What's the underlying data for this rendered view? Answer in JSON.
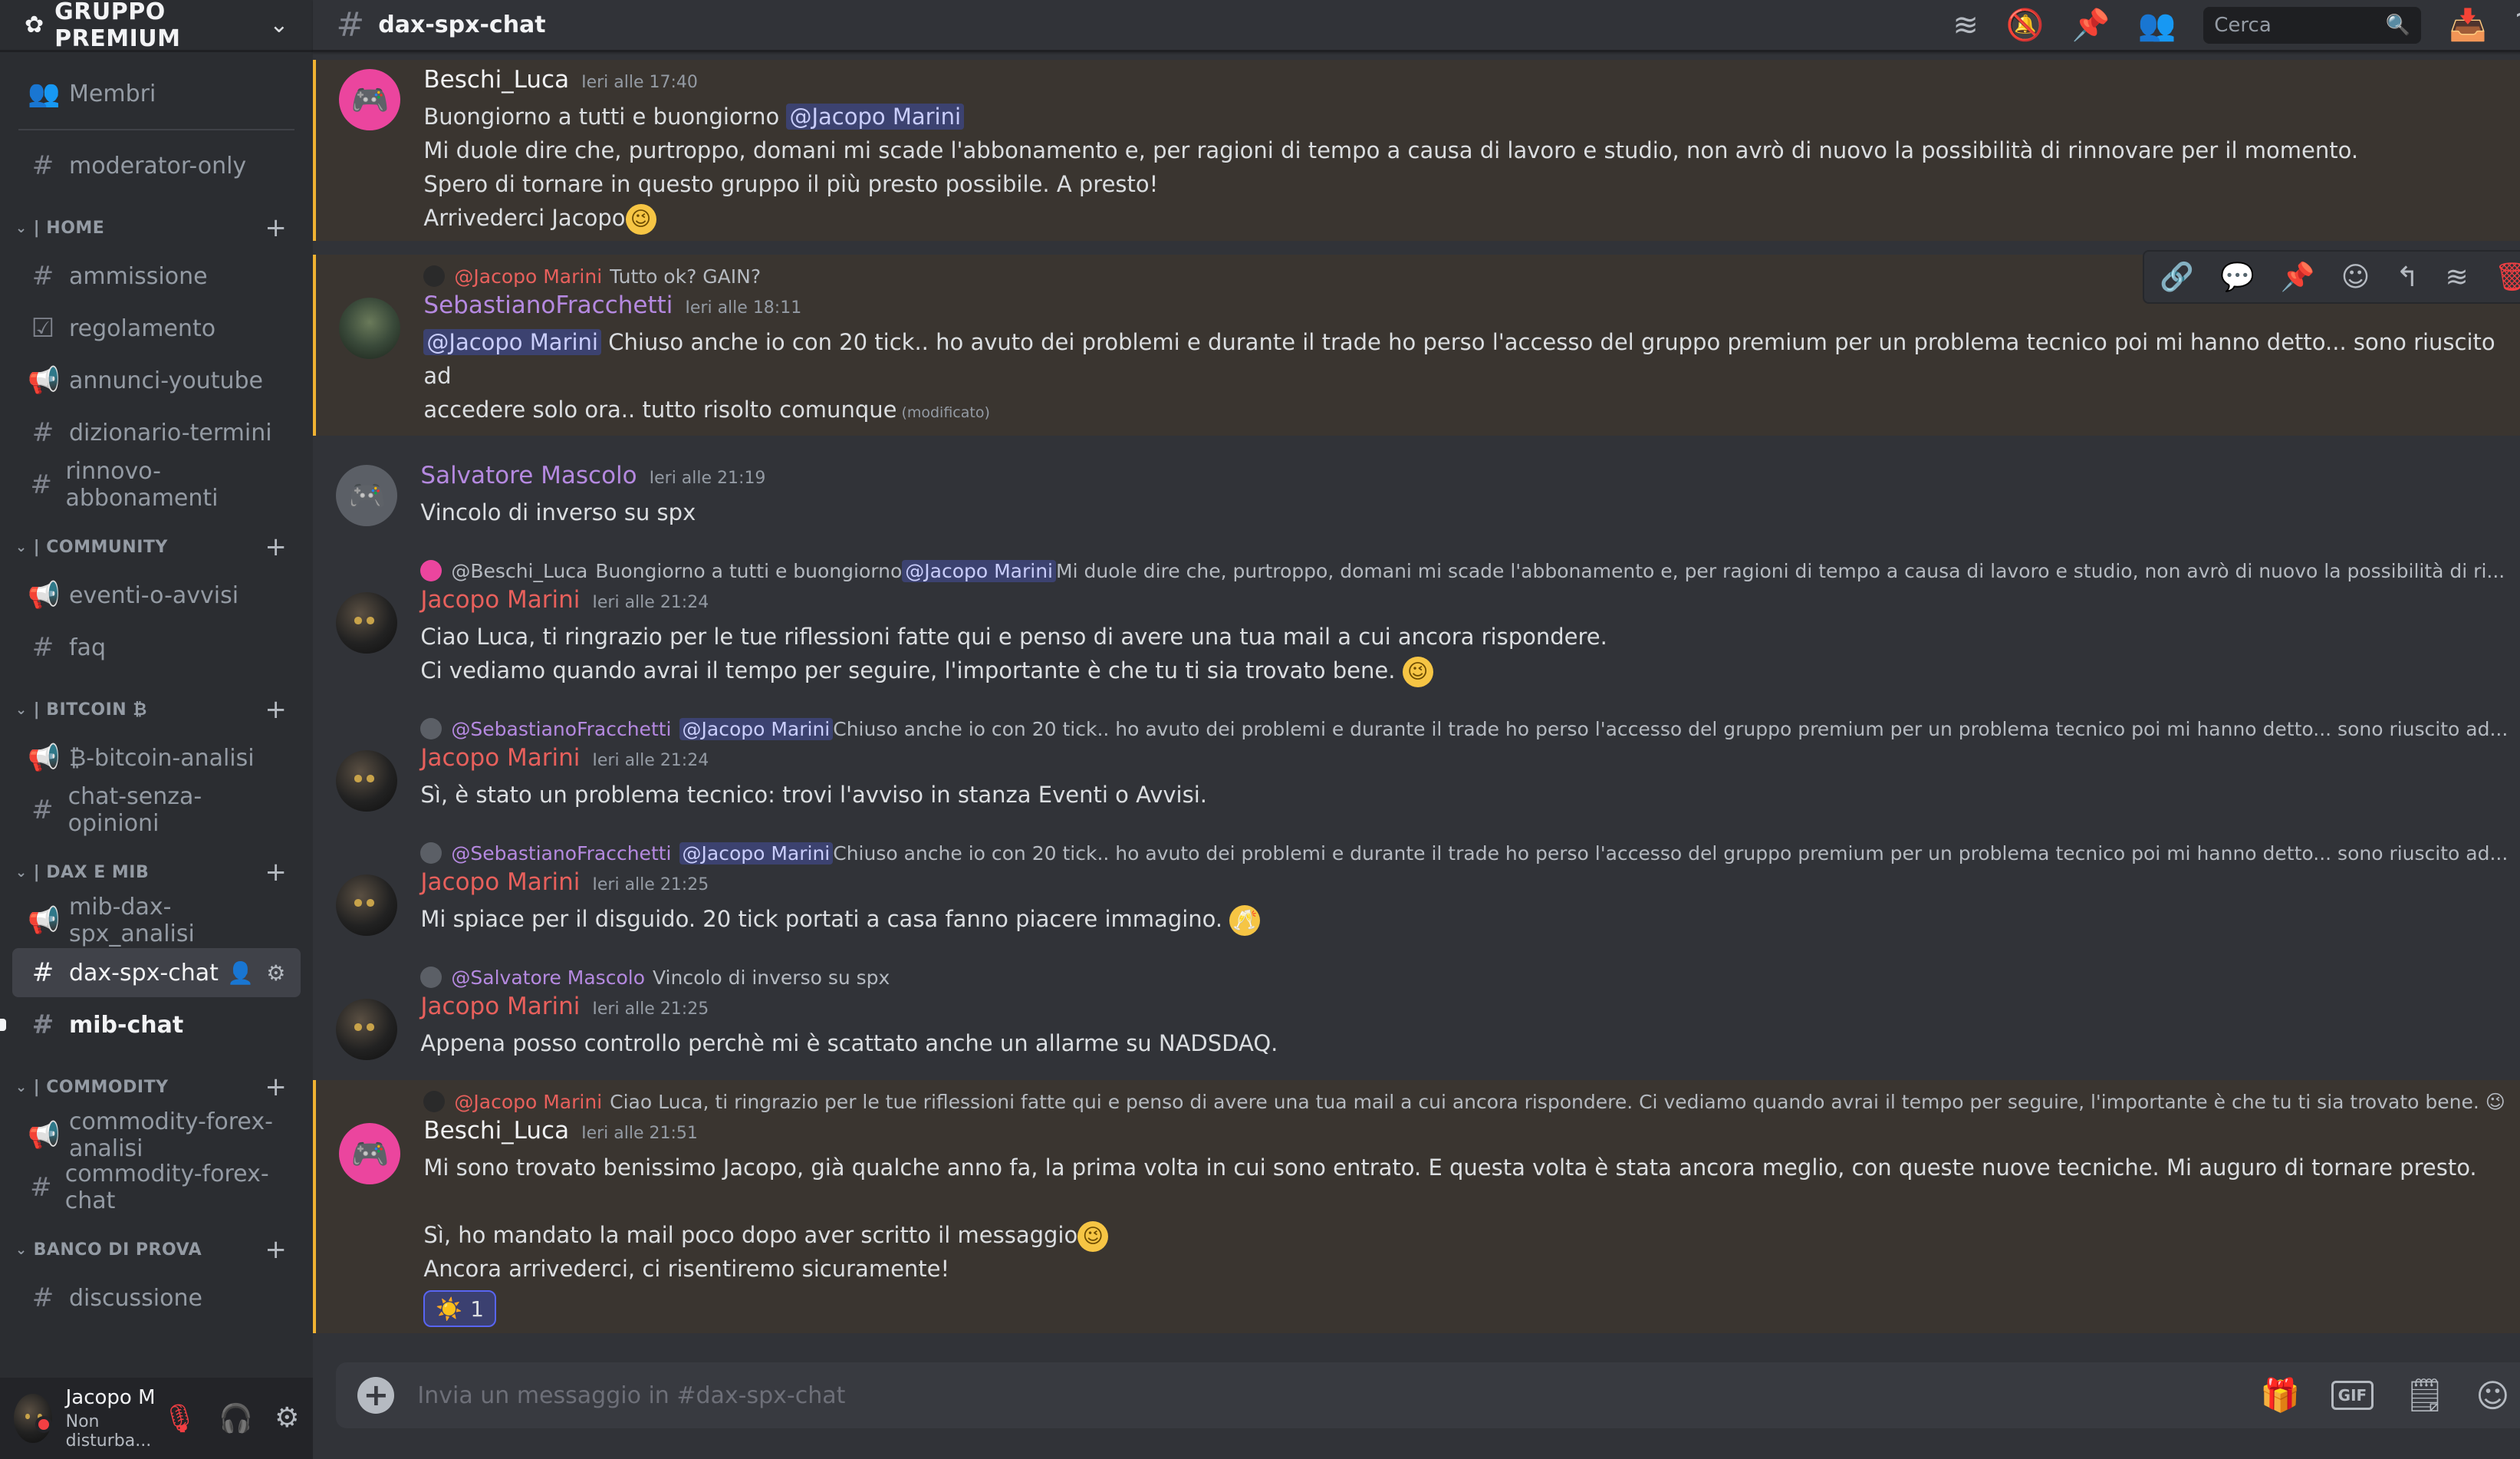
{
  "server": {
    "name": "GRUPPO PREMIUM"
  },
  "sidebar": {
    "top_items": [
      {
        "label": "Membri",
        "icon": "members-icon"
      },
      {
        "label": "moderator-only",
        "icon": "hash-icon"
      }
    ],
    "categories": [
      {
        "name": "| HOME",
        "channels": [
          {
            "label": "ammissione",
            "icon": "hash-icon"
          },
          {
            "label": "regolamento",
            "icon": "rules-icon"
          },
          {
            "label": "annunci-youtube",
            "icon": "announcement-icon"
          },
          {
            "label": "dizionario-termini",
            "icon": "hash-icon"
          },
          {
            "label": "rinnovo-abbonamenti",
            "icon": "hash-icon"
          }
        ]
      },
      {
        "name": "| COMMUNITY",
        "channels": [
          {
            "label": "eventi-o-avvisi",
            "icon": "announcement-icon"
          },
          {
            "label": "faq",
            "icon": "hash-icon"
          }
        ]
      },
      {
        "name": "| BITCOIN ₿",
        "channels": [
          {
            "label": "₿-bitcoin-analisi",
            "icon": "announcement-icon"
          },
          {
            "label": "chat-senza-opinioni",
            "icon": "hash-icon"
          }
        ]
      },
      {
        "name": "| DAX E MIB",
        "channels": [
          {
            "label": "mib-dax-spx_analisi",
            "icon": "announcement-icon"
          },
          {
            "label": "dax-spx-chat",
            "icon": "hash-icon",
            "active": true
          },
          {
            "label": "mib-chat",
            "icon": "hash-icon",
            "unread": true
          }
        ]
      },
      {
        "name": "| COMMODITY",
        "channels": [
          {
            "label": "commodity-forex-analisi",
            "icon": "announcement-icon"
          },
          {
            "label": "commodity-forex-chat",
            "icon": "hash-icon"
          }
        ]
      },
      {
        "name": "BANCO DI PROVA",
        "channels": [
          {
            "label": "discussione",
            "icon": "hash-icon"
          }
        ]
      }
    ]
  },
  "user_panel": {
    "name": "Jacopo M",
    "status": "Non disturba..."
  },
  "topbar": {
    "channel": "dax-spx-chat",
    "search_placeholder": "Cerca"
  },
  "messages": [
    {
      "author": "Beschi_Luca",
      "author_color": "#f2f3f5",
      "avatar": "discord-pink",
      "time": "Ieri alle 17:40",
      "mention": true,
      "lines": [
        [
          {
            "t": "Buongiorno a tutti e buongiorno "
          },
          {
            "m": "@Jacopo Marini"
          }
        ],
        [
          {
            "t": "Mi duole dire che, purtroppo, domani mi scade l'abbonamento e, per ragioni di tempo a causa di lavoro e studio, non avrò di nuovo la possibilità di rinnovare per il momento."
          }
        ],
        [
          {
            "t": "Spero di tornare in questo gruppo il più presto possibile. A presto!"
          }
        ],
        [
          {
            "t": "Arrivederci Jacopo"
          },
          {
            "e": "😉"
          }
        ]
      ]
    },
    {
      "author": "SebastianoFracchetti",
      "author_color": "#b589e0",
      "avatar": "tree",
      "time": "Ieri alle 18:11",
      "mention": true,
      "reply": {
        "author": "@Jacopo Marini",
        "author_color": "#e8605c",
        "text": "Tutto ok? GAIN?"
      },
      "lines": [
        [
          {
            "m": "@Jacopo Marini"
          },
          {
            "t": " Chiuso anche io con  20 tick.. ho avuto dei problemi e durante il trade ho perso l'accesso del gruppo premium per un problema tecnico poi mi hanno detto... sono riuscito ad"
          }
        ],
        [
          {
            "t": "accedere solo ora.. tutto risolto comunque"
          },
          {
            "ed": "(modificato)"
          }
        ]
      ]
    },
    {
      "author": "Salvatore Mascolo",
      "author_color": "#b589e0",
      "avatar": "discord-grey",
      "time": "Ieri alle 21:19",
      "lines": [
        [
          {
            "t": "Vincolo di inverso su spx"
          }
        ]
      ]
    },
    {
      "author": "Jacopo Marini",
      "author_color": "#e8605c",
      "avatar": "panther",
      "time": "Ieri alle 21:24",
      "reply": {
        "author": "@Beschi_Luca",
        "author_color": "#b5bac1",
        "mention": "@Jacopo Marini",
        "pre": "Buongiorno a tutti e buongiorno ",
        "text": " Mi duole dire che, purtroppo, domani mi scade l'abbonamento e, per ragioni di tempo a causa di lavoro e studio, non avrò di nuovo la possibilità di ri..."
      },
      "lines": [
        [
          {
            "t": "Ciao Luca, ti ringrazio per le tue riflessioni fatte qui e penso di avere una tua mail a cui ancora rispondere."
          }
        ],
        [
          {
            "t": "Ci vediamo quando avrai il tempo per seguire, l'importante è che tu ti sia trovato bene. "
          },
          {
            "e": "😉"
          }
        ]
      ]
    },
    {
      "author": "Jacopo Marini",
      "author_color": "#e8605c",
      "avatar": "panther",
      "time": "Ieri alle 21:24",
      "reply": {
        "author": "@SebastianoFracchetti",
        "author_color": "#b589e0",
        "mention": "@Jacopo Marini",
        "pre": "",
        "text": " Chiuso anche io con  20 tick.. ho avuto dei problemi e durante il trade ho perso l'accesso del gruppo premium per un problema tecnico poi mi hanno detto... sono riuscito ad..."
      },
      "lines": [
        [
          {
            "t": "Sì, è stato un problema tecnico: trovi l'avviso in stanza Eventi o Avvisi."
          }
        ]
      ]
    },
    {
      "author": "Jacopo Marini",
      "author_color": "#e8605c",
      "avatar": "panther",
      "time": "Ieri alle 21:25",
      "reply": {
        "author": "@SebastianoFracchetti",
        "author_color": "#b589e0",
        "mention": "@Jacopo Marini",
        "pre": "",
        "text": " Chiuso anche io con  20 tick.. ho avuto dei problemi e durante il trade ho perso l'accesso del gruppo premium per un problema tecnico poi mi hanno detto... sono riuscito ad..."
      },
      "lines": [
        [
          {
            "t": "Mi spiace per il disguido. 20 tick portati a casa fanno piacere immagino. "
          },
          {
            "e": "🥂"
          }
        ]
      ]
    },
    {
      "author": "Jacopo Marini",
      "author_color": "#e8605c",
      "avatar": "panther",
      "time": "Ieri alle 21:25",
      "reply": {
        "author": "@Salvatore Mascolo",
        "author_color": "#b589e0",
        "text": "Vincolo di inverso su spx"
      },
      "lines": [
        [
          {
            "t": "Appena posso controllo perchè mi è scattato anche un allarme su NADSDAQ."
          }
        ]
      ]
    },
    {
      "author": "Beschi_Luca",
      "author_color": "#f2f3f5",
      "avatar": "discord-pink",
      "time": "Ieri alle 21:51",
      "mention": true,
      "reply": {
        "author": "@Jacopo Marini",
        "author_color": "#e8605c",
        "text": "Ciao Luca, ti ringrazio per le tue riflessioni fatte qui e penso di avere una tua mail a cui ancora rispondere.  Ci vediamo quando avrai il tempo per seguire, l'importante è che tu ti sia trovato bene. 😉"
      },
      "lines": [
        [
          {
            "t": "Mi sono trovato benissimo Jacopo, già qualche anno fa, la prima volta in cui sono entrato. E questa volta è stata ancora meglio, con queste nuove tecniche. Mi auguro di tornare presto."
          }
        ],
        [
          {
            "t": " "
          }
        ],
        [
          {
            "t": "Sì, ho mandato la mail poco dopo aver scritto il messaggio"
          },
          {
            "e": "😉"
          }
        ],
        [
          {
            "t": "Ancora arrivederci, ci risentiremo sicuramente!"
          }
        ]
      ],
      "reaction": {
        "emoji": "☀️",
        "count": "1"
      }
    }
  ],
  "composer": {
    "placeholder": "Invia un messaggio in #dax-spx-chat"
  }
}
